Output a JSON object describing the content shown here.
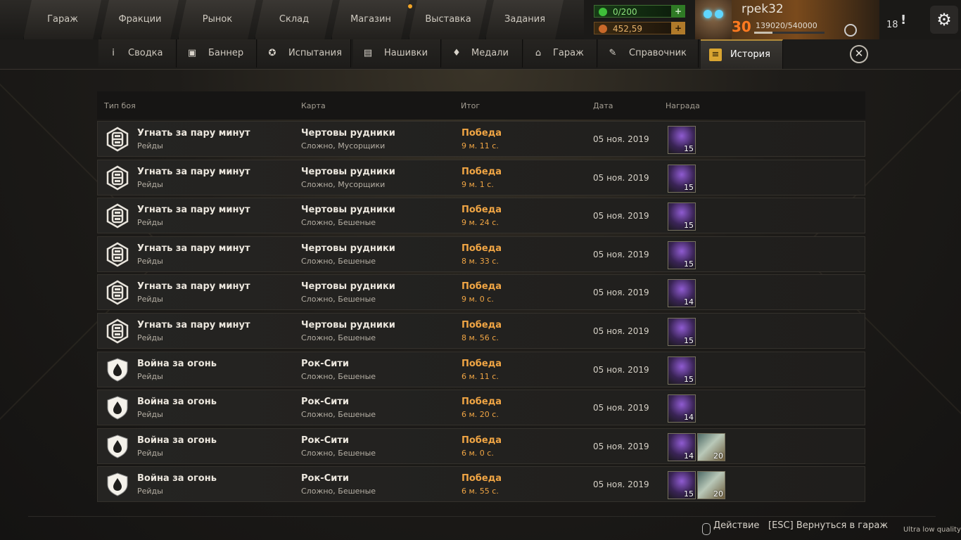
{
  "top_nav": [
    "Гараж",
    "Фракции",
    "Рынок",
    "Склад",
    "Магазин",
    "Выставка",
    "Задания"
  ],
  "resources": {
    "energy": "0/200",
    "coins": "452,59"
  },
  "profile": {
    "name": "rpek32",
    "level": "30",
    "xp": "139020/540000",
    "xp_fraction": 0.2574
  },
  "notifications": "18",
  "tabs": [
    {
      "label": "Сводка",
      "icon": "info-icon"
    },
    {
      "label": "Баннер",
      "icon": "banner-icon"
    },
    {
      "label": "Испытания",
      "icon": "challenge-icon"
    },
    {
      "label": "Нашивки",
      "icon": "badge-icon"
    },
    {
      "label": "Медали",
      "icon": "medal-icon"
    },
    {
      "label": "Гараж",
      "icon": "garage-icon"
    },
    {
      "label": "Справочник",
      "icon": "handbook-icon"
    },
    {
      "label": "История",
      "icon": "history-icon"
    }
  ],
  "table": {
    "headers": {
      "type": "Тип боя",
      "map": "Карта",
      "result": "Итог",
      "date": "Дата",
      "reward": "Награда"
    },
    "rows": [
      {
        "icon": "raid-truck-icon",
        "mode": "Угнать за пару минут",
        "sub": "Рейды",
        "map": "Чертовы рудники",
        "difficulty": "Сложно, Мусорщики",
        "result": "Победа",
        "time": "9 м. 11 с.",
        "date": "05 ноя. 2019",
        "rewards": [
          {
            "type": "purple",
            "count": "15"
          }
        ]
      },
      {
        "icon": "raid-truck-icon",
        "mode": "Угнать за пару минут",
        "sub": "Рейды",
        "map": "Чертовы рудники",
        "difficulty": "Сложно, Мусорщики",
        "result": "Победа",
        "time": "9 м. 1 с.",
        "date": "05 ноя. 2019",
        "rewards": [
          {
            "type": "purple",
            "count": "15"
          }
        ]
      },
      {
        "icon": "raid-truck-icon",
        "mode": "Угнать за пару минут",
        "sub": "Рейды",
        "map": "Чертовы рудники",
        "difficulty": "Сложно, Бешеные",
        "result": "Победа",
        "time": "9 м. 24 с.",
        "date": "05 ноя. 2019",
        "rewards": [
          {
            "type": "purple",
            "count": "15"
          }
        ]
      },
      {
        "icon": "raid-truck-icon",
        "mode": "Угнать за пару минут",
        "sub": "Рейды",
        "map": "Чертовы рудники",
        "difficulty": "Сложно, Бешеные",
        "result": "Победа",
        "time": "8 м. 33 с.",
        "date": "05 ноя. 2019",
        "rewards": [
          {
            "type": "purple",
            "count": "15"
          }
        ]
      },
      {
        "icon": "raid-truck-icon",
        "mode": "Угнать за пару минут",
        "sub": "Рейды",
        "map": "Чертовы рудники",
        "difficulty": "Сложно, Бешеные",
        "result": "Победа",
        "time": "9 м. 0 с.",
        "date": "05 ноя. 2019",
        "rewards": [
          {
            "type": "purple",
            "count": "14"
          }
        ]
      },
      {
        "icon": "raid-truck-icon",
        "mode": "Угнать за пару минут",
        "sub": "Рейды",
        "map": "Чертовы рудники",
        "difficulty": "Сложно, Бешеные",
        "result": "Победа",
        "time": "8 м. 56 с.",
        "date": "05 ноя. 2019",
        "rewards": [
          {
            "type": "purple",
            "count": "15"
          }
        ]
      },
      {
        "icon": "fire-shield-icon",
        "mode": "Война за огонь",
        "sub": "Рейды",
        "map": "Рок-Сити",
        "difficulty": "Сложно, Бешеные",
        "result": "Победа",
        "time": "6 м. 11 с.",
        "date": "05 ноя. 2019",
        "rewards": [
          {
            "type": "purple",
            "count": "15"
          }
        ]
      },
      {
        "icon": "fire-shield-icon",
        "mode": "Война за огонь",
        "sub": "Рейды",
        "map": "Рок-Сити",
        "difficulty": "Сложно, Бешеные",
        "result": "Победа",
        "time": "6 м. 20 с.",
        "date": "05 ноя. 2019",
        "rewards": [
          {
            "type": "purple",
            "count": "14"
          }
        ]
      },
      {
        "icon": "fire-shield-icon",
        "mode": "Война за огонь",
        "sub": "Рейды",
        "map": "Рок-Сити",
        "difficulty": "Сложно, Бешеные",
        "result": "Победа",
        "time": "6 м. 0 с.",
        "date": "05 ноя. 2019",
        "rewards": [
          {
            "type": "purple",
            "count": "14"
          },
          {
            "type": "money",
            "count": "20"
          }
        ]
      },
      {
        "icon": "fire-shield-icon",
        "mode": "Война за огонь",
        "sub": "Рейды",
        "map": "Рок-Сити",
        "difficulty": "Сложно, Бешеные",
        "result": "Победа",
        "time": "6 м. 55 с.",
        "date": "05 ноя. 2019",
        "rewards": [
          {
            "type": "purple",
            "count": "15"
          },
          {
            "type": "money",
            "count": "20"
          }
        ]
      }
    ]
  },
  "footer": {
    "action": "Действие",
    "esc": "[ESC] Вернуться в гараж",
    "quality": "Ultra low quality"
  },
  "colors": {
    "accent": "#f0a544",
    "energy": "#8be07a",
    "active_tab": "#d9a531"
  }
}
